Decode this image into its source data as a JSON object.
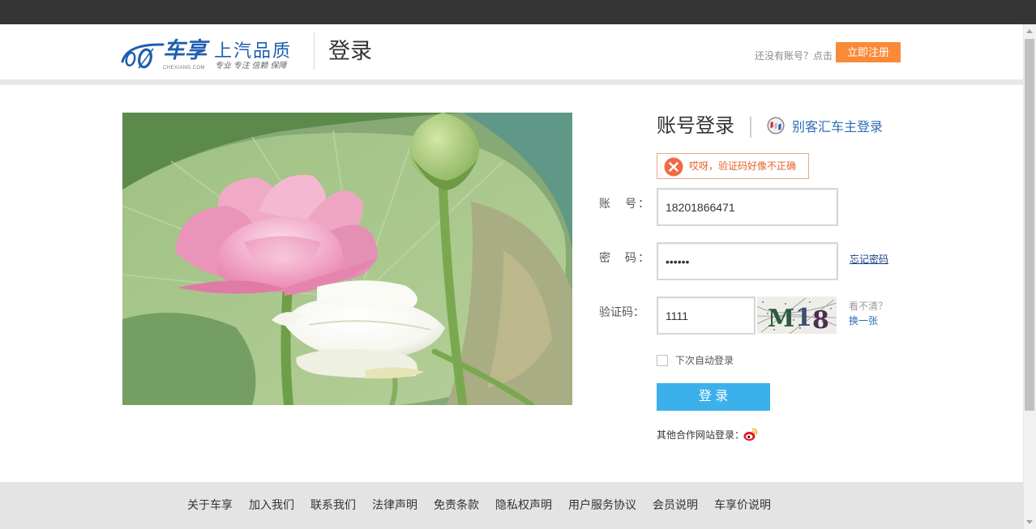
{
  "header": {
    "logo": {
      "brand": "车享",
      "domain": "CHEXIANG.COM",
      "slogan_title": "上汽品质",
      "slogan_sub": "专业 专注 信赖 保障"
    },
    "page_title": "登录",
    "register_prompt": "还没有账号？点击",
    "register_button": "立即注册"
  },
  "login": {
    "title": "账号登录",
    "alt_login": "别客汇车主登录",
    "alt_login_icon": "buick-logo-icon",
    "error": "哎呀，验证码好像不正确",
    "error_icon": "close-circle-icon",
    "account": {
      "label": "账　号：",
      "value": "18201866471"
    },
    "password": {
      "label": "密　码：",
      "value": "••••••"
    },
    "forgot": "忘记密码",
    "captcha": {
      "label": "验证码：",
      "value": "1111",
      "chars": [
        "M",
        "1",
        "8"
      ],
      "hint": "看不清？",
      "refresh": "换一张"
    },
    "remember": {
      "label": "下次自动登录",
      "checked": false
    },
    "submit": "登 录",
    "partner_label": "其他合作网站登录：",
    "partner_icon": "weibo-icon"
  },
  "footer": {
    "links": [
      "关于车享",
      "加入我们",
      "联系我们",
      "法律声明",
      "免责条款",
      "隐私权声明",
      "用户服务协议",
      "会员说明",
      "车享价说明"
    ]
  },
  "colors": {
    "top_bar": "#353535",
    "brand_blue": "#1e5eb0",
    "register_orange": "#f98a37",
    "login_button": "#3cb0ea",
    "error_text": "#e8622a",
    "link_blue": "#2d6cb5",
    "footer_bg": "#e4e4e4"
  }
}
